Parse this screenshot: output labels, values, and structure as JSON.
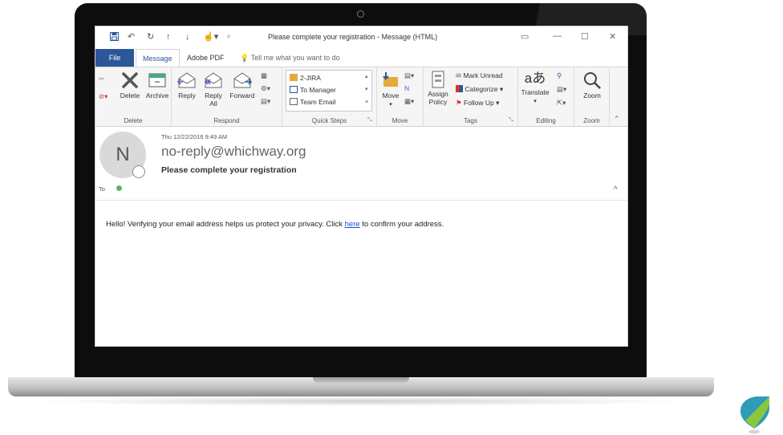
{
  "window": {
    "title": "Please complete your registration - Message (HTML)"
  },
  "tabs": {
    "file": "File",
    "message": "Message",
    "adobe_pdf": "Adobe PDF",
    "tell_me": "Tell me what you want to do"
  },
  "ribbon": {
    "delete_group": {
      "label": "Delete",
      "delete": "Delete",
      "archive": "Archive"
    },
    "respond_group": {
      "label": "Respond",
      "reply": "Reply",
      "reply_all_line1": "Reply",
      "reply_all_line2": "All",
      "forward": "Forward"
    },
    "quick_steps_group": {
      "label": "Quick Steps",
      "items": [
        "2-JIRA",
        "To Manager",
        "Team Email"
      ]
    },
    "move_group": {
      "label": "Move",
      "move": "Move"
    },
    "tags_group": {
      "label": "Tags",
      "assign_policy_line1": "Assign",
      "assign_policy_line2": "Policy",
      "mark_unread": "Mark Unread",
      "categorize": "Categorize",
      "follow_up": "Follow Up"
    },
    "editing_group": {
      "label": "Editing",
      "translate": "Translate"
    },
    "zoom_group": {
      "label": "Zoom",
      "zoom": "Zoom"
    }
  },
  "message": {
    "avatar_letter": "N",
    "date": "Thu 12/22/2016 9:49 AM",
    "sender": "no-reply@whichway.org",
    "subject": "Please complete your registration",
    "to_label": "To",
    "body_before_link": "Hello! Verifying your email address helps us protect your privacy. Click ",
    "body_link": "here",
    "body_after_link": " to confirm your address."
  },
  "colors": {
    "accent": "#2b579a",
    "link": "#1a53c9",
    "presence_green": "#5cb85c",
    "follow_up_flag": "#d9342b"
  }
}
